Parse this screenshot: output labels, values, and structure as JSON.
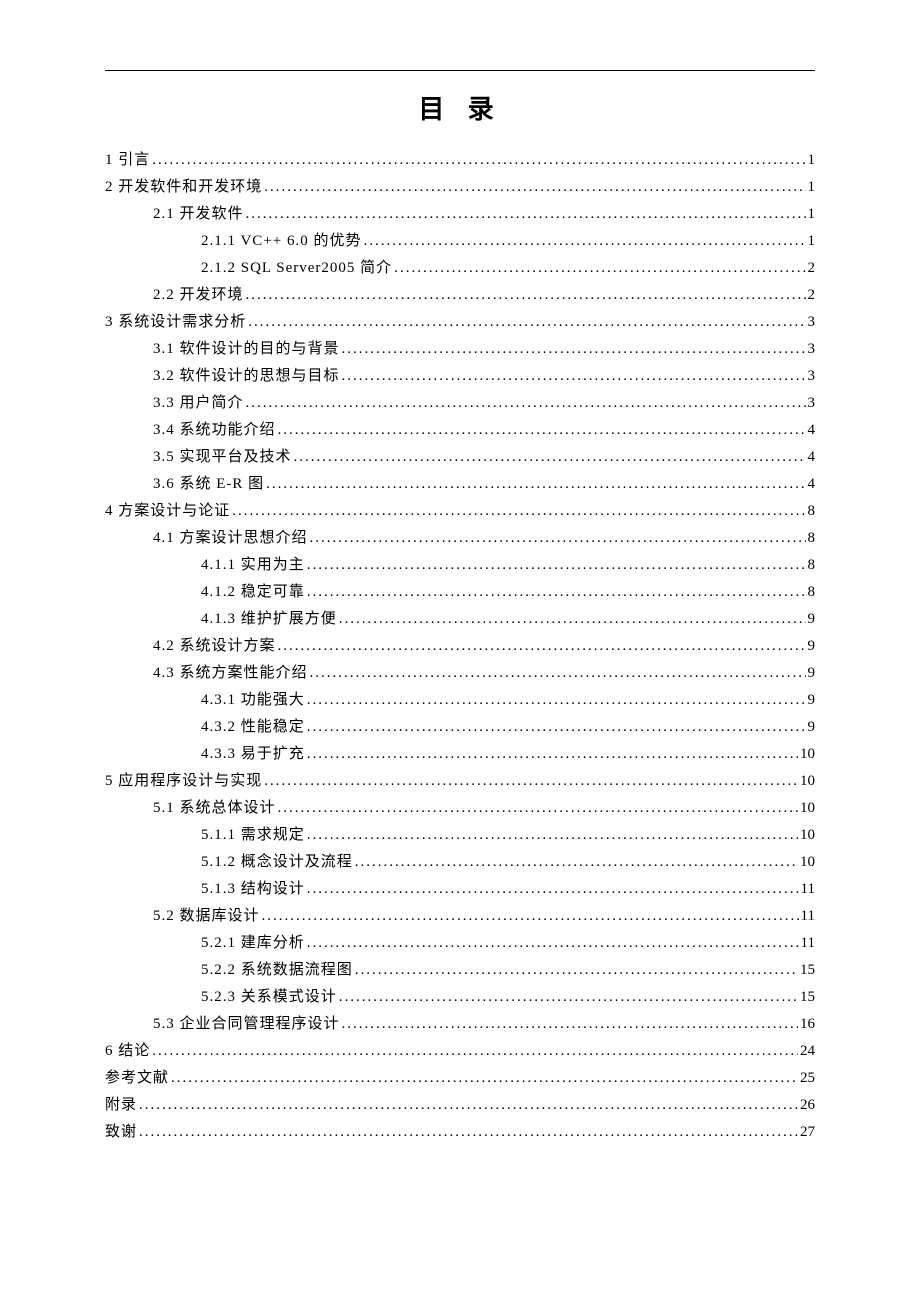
{
  "title": "目 录",
  "toc": [
    {
      "level": 0,
      "label": "1 引言",
      "page": "1"
    },
    {
      "level": 0,
      "label": "2 开发软件和开发环境",
      "page": "1"
    },
    {
      "level": 1,
      "label": "2.1 开发软件",
      "page": "1"
    },
    {
      "level": 2,
      "label": "2.1.1 VC++ 6.0 的优势",
      "page": "1"
    },
    {
      "level": 2,
      "label": "2.1.2 SQL Server2005 简介",
      "page": "2"
    },
    {
      "level": 1,
      "label": "2.2 开发环境",
      "page": "2"
    },
    {
      "level": 0,
      "label": "3 系统设计需求分析",
      "page": "3"
    },
    {
      "level": 1,
      "label": "3.1 软件设计的目的与背景",
      "page": "3"
    },
    {
      "level": 1,
      "label": "3.2 软件设计的思想与目标",
      "page": "3"
    },
    {
      "level": 1,
      "label": "3.3 用户简介",
      "page": "3"
    },
    {
      "level": 1,
      "label": "3.4 系统功能介绍",
      "page": "4"
    },
    {
      "level": 1,
      "label": "3.5 实现平台及技术",
      "page": "4"
    },
    {
      "level": 1,
      "label": "3.6 系统 E-R 图",
      "page": "4"
    },
    {
      "level": 0,
      "label": "4 方案设计与论证",
      "page": "8"
    },
    {
      "level": 1,
      "label": "4.1 方案设计思想介绍",
      "page": "8"
    },
    {
      "level": 2,
      "label": "4.1.1 实用为主",
      "page": "8"
    },
    {
      "level": 2,
      "label": "4.1.2 稳定可靠",
      "page": "8"
    },
    {
      "level": 2,
      "label": "4.1.3 维护扩展方便",
      "page": "9"
    },
    {
      "level": 1,
      "label": "4.2 系统设计方案",
      "page": "9"
    },
    {
      "level": 1,
      "label": "4.3 系统方案性能介绍",
      "page": "9"
    },
    {
      "level": 2,
      "label": "4.3.1 功能强大",
      "page": "9"
    },
    {
      "level": 2,
      "label": "4.3.2 性能稳定",
      "page": "9"
    },
    {
      "level": 2,
      "label": "4.3.3 易于扩充",
      "page": "10"
    },
    {
      "level": 0,
      "label": "5 应用程序设计与实现",
      "page": "10"
    },
    {
      "level": 1,
      "label": "5.1 系统总体设计",
      "page": "10"
    },
    {
      "level": 2,
      "label": "5.1.1 需求规定",
      "page": "10"
    },
    {
      "level": 2,
      "label": "5.1.2 概念设计及流程",
      "page": "10"
    },
    {
      "level": 2,
      "label": "5.1.3 结构设计",
      "page": "11"
    },
    {
      "level": 1,
      "label": "5.2 数据库设计",
      "page": "11"
    },
    {
      "level": 2,
      "label": "5.2.1 建库分析",
      "page": "11"
    },
    {
      "level": 2,
      "label": "5.2.2 系统数据流程图",
      "page": "15"
    },
    {
      "level": 2,
      "label": "5.2.3 关系模式设计",
      "page": "15"
    },
    {
      "level": 1,
      "label": "5.3 企业合同管理程序设计",
      "page": "16"
    },
    {
      "level": 0,
      "label": "6 结论",
      "page": "24"
    },
    {
      "level": 0,
      "label": "参考文献",
      "page": "25"
    },
    {
      "level": 0,
      "label": "附录",
      "page": "26"
    },
    {
      "level": 0,
      "label": "致谢",
      "page": "27"
    }
  ]
}
